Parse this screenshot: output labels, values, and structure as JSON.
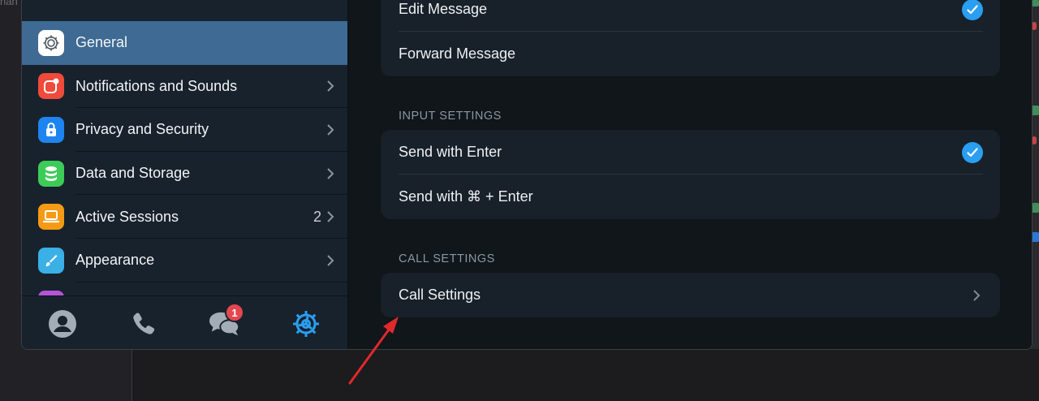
{
  "background": {
    "left_fragment": "nan"
  },
  "sidebar": {
    "items": [
      {
        "label": "General",
        "icon": "gear-icon",
        "color": "#ffffff",
        "active": true
      },
      {
        "label": "Notifications and Sounds",
        "icon": "notification-icon",
        "color": "#ef4a3b"
      },
      {
        "label": "Privacy and Security",
        "icon": "lock-icon",
        "color": "#1e84f0"
      },
      {
        "label": "Data and Storage",
        "icon": "database-icon",
        "color": "#3ccc57"
      },
      {
        "label": "Active Sessions",
        "icon": "laptop-icon",
        "color": "#f59a14",
        "count": "2"
      },
      {
        "label": "Appearance",
        "icon": "brush-icon",
        "color": "#3ab0e6"
      }
    ]
  },
  "tabbar": {
    "tabs": [
      "profile-icon",
      "phone-icon",
      "chats-icon",
      "settings-icon"
    ],
    "chats_badge": "1",
    "active": "settings-icon"
  },
  "content": {
    "messages_group": {
      "rows": [
        {
          "label": "Edit Message",
          "checked": true
        },
        {
          "label": "Forward Message",
          "checked": false
        }
      ]
    },
    "input_settings": {
      "title": "INPUT SETTINGS",
      "rows": [
        {
          "label": "Send with Enter",
          "checked": true
        },
        {
          "label": "Send with ⌘ + Enter",
          "checked": false
        }
      ]
    },
    "call_settings": {
      "title": "CALL SETTINGS",
      "rows": [
        {
          "label": "Call Settings"
        }
      ]
    }
  },
  "colors": {
    "accent": "#2a9ef1",
    "active_row": "#3e6a93",
    "badge": "#e5474d",
    "annotation_arrow": "#e0292b"
  }
}
